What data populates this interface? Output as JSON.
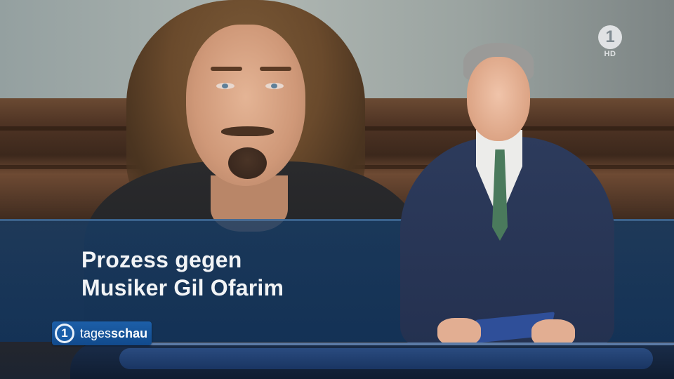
{
  "broadcast": {
    "channel_logo": {
      "text": "1",
      "label": "HD",
      "icon": "ard-logo"
    },
    "program_logo": {
      "icon_text": "1",
      "word_regular": "tages",
      "word_bold": "schau",
      "icon": "tagesschau-logo"
    }
  },
  "headline": {
    "line1": "Prozess gegen",
    "line2": "Musiker Gil Ofarim"
  },
  "colors": {
    "band": "#174a82",
    "logo_blue": "#1a5ea8",
    "headline_text": "#f2f4f6"
  }
}
